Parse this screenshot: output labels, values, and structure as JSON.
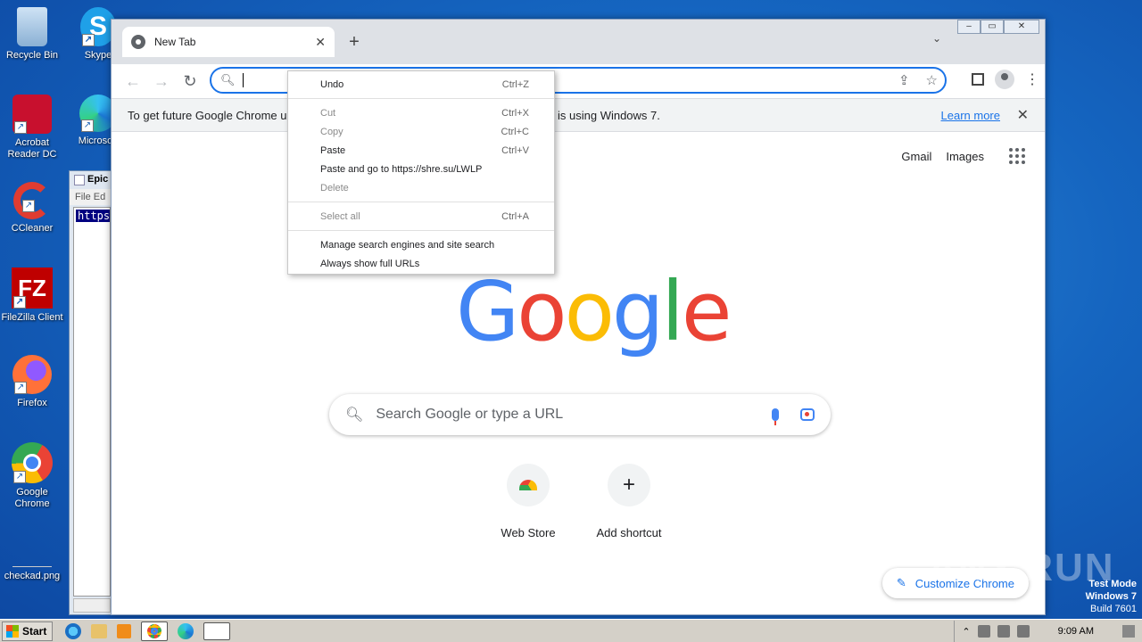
{
  "desktop": {
    "icons": [
      {
        "label": "Recycle Bin"
      },
      {
        "label": "Skype"
      },
      {
        "label": "Acrobat Reader DC"
      },
      {
        "label": "Microsoft"
      },
      {
        "label": "CCleaner"
      },
      {
        "label": "FileZilla Client"
      },
      {
        "label": "Firefox"
      },
      {
        "label": "Google Chrome"
      },
      {
        "label": "checkad.png"
      }
    ]
  },
  "notepad": {
    "title": "Epic",
    "menu": "File  Ed",
    "selected_text": "https"
  },
  "chrome": {
    "tab_title": "New Tab",
    "omnibox_value": "",
    "infobar": {
      "message": "To get future Google Chrome up",
      "message_tail": "is using Windows 7.",
      "learn_more": "Learn more"
    },
    "ntp": {
      "gmail": "Gmail",
      "images": "Images",
      "logo": [
        "G",
        "o",
        "o",
        "g",
        "l",
        "e"
      ],
      "search_placeholder": "Search Google or type a URL",
      "shortcuts": [
        {
          "label": "Web Store"
        },
        {
          "label": "Add shortcut"
        }
      ],
      "customize": "Customize Chrome"
    }
  },
  "context_menu": {
    "groups": [
      [
        {
          "label": "Undo",
          "shortcut": "Ctrl+Z",
          "enabled": true
        }
      ],
      [
        {
          "label": "Cut",
          "shortcut": "Ctrl+X",
          "enabled": false
        },
        {
          "label": "Copy",
          "shortcut": "Ctrl+C",
          "enabled": false
        },
        {
          "label": "Paste",
          "shortcut": "Ctrl+V",
          "enabled": true
        },
        {
          "label": "Paste and go to https://shre.su/LWLP",
          "shortcut": "",
          "enabled": true
        },
        {
          "label": "Delete",
          "shortcut": "",
          "enabled": false
        }
      ],
      [
        {
          "label": "Select all",
          "shortcut": "Ctrl+A",
          "enabled": false
        }
      ],
      [
        {
          "label": "Manage search engines and site search",
          "shortcut": "",
          "enabled": true
        },
        {
          "label": "Always show full URLs",
          "shortcut": "",
          "enabled": true
        }
      ]
    ]
  },
  "watermark": "ANY.RUN",
  "test_mode": {
    "line1": "Test Mode",
    "line2": "Windows 7",
    "line3": "Build 7601"
  },
  "taskbar": {
    "start": "Start",
    "clock": "9:09 AM"
  }
}
